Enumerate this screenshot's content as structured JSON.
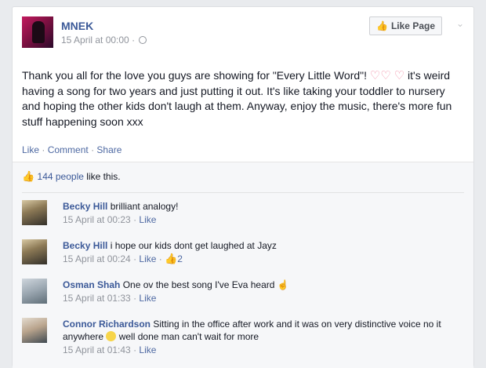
{
  "post": {
    "page_name": "MNEK",
    "timestamp": "15 April at 00:00 ·",
    "like_page_label": "Like Page",
    "text_part1": "Thank you all for the love you guys are showing for \"Every Little Word\"!",
    "text_part2": "it's weird having a song for two years and just putting it out. It's like taking your toddler to nursery and hoping the other kids don't laugh at them. Anyway, enjoy the music, there's more fun stuff happening soon xxx",
    "actions": {
      "like": "Like",
      "comment": "Comment",
      "share": "Share"
    }
  },
  "likes": {
    "count_text": "144 people",
    "suffix": " like this."
  },
  "comments": [
    {
      "author": "Becky Hill",
      "text": "brilliant analogy!",
      "time": "15 April at 00:23",
      "like": "Like",
      "like_count": ""
    },
    {
      "author": "Becky Hill",
      "text": "i hope our kids dont get laughed at Jayz",
      "time": "15 April at 00:24",
      "like": "Like",
      "like_count": "2"
    },
    {
      "author": "Osman Shah",
      "text": "One ov the best song I've Eva heard",
      "time": "15 April at 01:33",
      "like": "Like",
      "like_count": ""
    },
    {
      "author": "Connor Richardson",
      "text_a": "Sitting in the office after work and it was on very distinctive voice no it anywhere",
      "text_b": "well done man can't wait for more",
      "time": "15 April at 01:43",
      "like": "Like",
      "like_count": ""
    }
  ],
  "colors": {
    "link": "#3b5998",
    "meta": "#90949c",
    "heart": "#f18ea6",
    "thumb": "#5890ff"
  },
  "icons": {
    "privacy": "globe-icon",
    "like_page": "thumbs-up-icon",
    "menu": "chevron-down-icon",
    "likes": "thumbs-up-outline-icon"
  }
}
